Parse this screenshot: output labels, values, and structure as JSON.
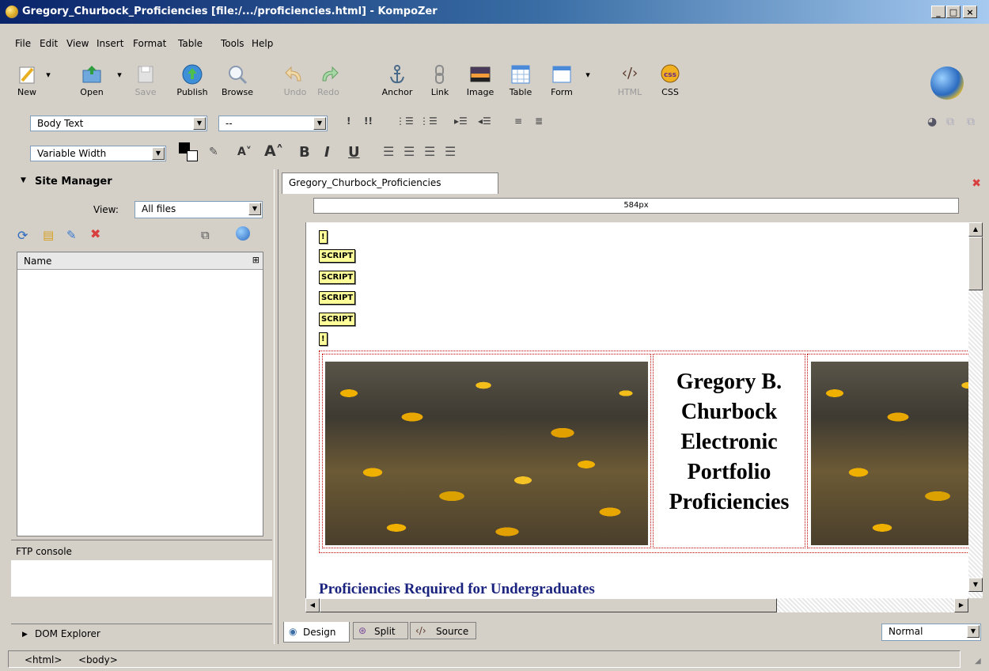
{
  "window": {
    "title": "Gregory_Churbock_Proficiencies [file:/.../proficiencies.html] - KompoZer",
    "min_label": "_",
    "max_label": "□",
    "close_label": "×"
  },
  "menu": [
    "File",
    "Edit",
    "View",
    "Insert",
    "Format",
    "Table",
    "Tools",
    "Help"
  ],
  "toolbar": {
    "new": "New",
    "open": "Open",
    "save": "Save",
    "publish": "Publish",
    "browse": "Browse",
    "undo": "Undo",
    "redo": "Redo",
    "anchor": "Anchor",
    "link": "Link",
    "image": "Image",
    "table": "Table",
    "form": "Form",
    "html": "HTML",
    "css": "CSS"
  },
  "format": {
    "paragraph_style": "Body Text",
    "class_value": "--",
    "font": "Variable Width"
  },
  "site_manager": {
    "title": "Site Manager",
    "view_label": "View:",
    "view_value": "All files",
    "name_column": "Name"
  },
  "ftp_console": "FTP console",
  "dom_explorer": "DOM Explorer",
  "editor": {
    "tab_title": "Gregory_Churbock_Proficiencies",
    "ruler_label": "584px",
    "tag_bang": "!",
    "tag_script": "SCRIPT",
    "page_heading": "Gregory B. Churbock Electronic Portfolio Proficiencies",
    "subheading": "Proficiencies Required for Undergraduates"
  },
  "view_modes": {
    "design": "Design",
    "split": "Split",
    "source": "Source"
  },
  "edit_mode": "Normal",
  "status": {
    "breadcrumb_html": "<html>",
    "breadcrumb_body": "<body>"
  }
}
